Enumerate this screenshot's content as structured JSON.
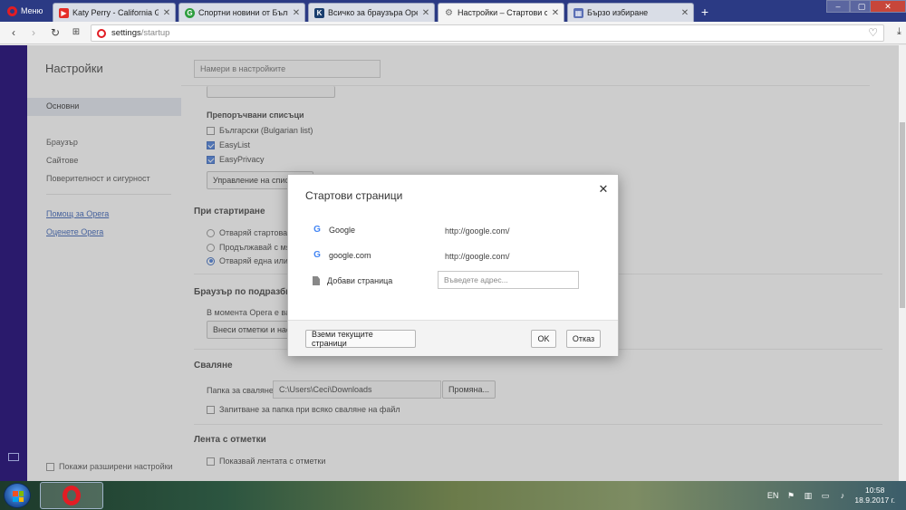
{
  "browser": {
    "menu_label": "Меню",
    "tabs": [
      {
        "title": "Katy Perry - California Gurl",
        "favicon": "youtube-icon",
        "favicon_color": "#e52d27"
      },
      {
        "title": "Спортни новини от България",
        "favicon": "green-g-icon",
        "favicon_color": "#2e9e3e"
      },
      {
        "title": "Всичко за браузъра Opera",
        "favicon": "k-icon",
        "favicon_color": "#1a3e6e"
      },
      {
        "title": "Настройки – Стартови стр",
        "favicon": "gear-icon",
        "favicon_color": "#666666"
      },
      {
        "title": "Бързо избиране",
        "favicon": "speed-dial-icon",
        "favicon_color": "#5a6fb5"
      }
    ],
    "new_tab_symbol": "+",
    "url_host": "settings",
    "url_path": "/startup",
    "accent_color": "#e21d24"
  },
  "settings": {
    "title": "Настройки",
    "search_placeholder": "Намери в настройките",
    "nav": {
      "basic": "Основни",
      "browser": "Браузър",
      "websites": "Сайтове",
      "privacy": "Поверителност и сигурност",
      "help_link": "Помощ за Opera",
      "rate_link": "Оценете Opera"
    },
    "show_advanced": "Покажи разширени настройки",
    "adblock": {
      "lists_title": "Препоръчвани списъци",
      "lists": [
        {
          "label": "Български (Bulgarian list)",
          "checked": false
        },
        {
          "label": "EasyList",
          "checked": true
        },
        {
          "label": "EasyPrivacy",
          "checked": true
        }
      ],
      "manage_button": "Управление на спис"
    },
    "startup": {
      "title": "При стартиране",
      "options": [
        {
          "label": "Отваряй стартовата",
          "selected": false
        },
        {
          "label": "Продължавай с мя",
          "selected": false
        },
        {
          "label": "Отваряй една или",
          "selected": true
        }
      ]
    },
    "default_browser": {
      "title": "Браузър по подразбир",
      "text": "В момента Opera е ваш",
      "import_button": "Внеси отметки и наст"
    },
    "downloads": {
      "title": "Сваляне",
      "folder_label": "Папка за сваляне:",
      "folder_path": "C:\\Users\\Ceci\\Downloads",
      "change_button": "Промяна...",
      "ask_label": "Запитване за папка при всяко сваляне на файл"
    },
    "bookmarks_bar": {
      "title": "Лента с отметки",
      "show_label": "Показвай лентата с отметки"
    }
  },
  "dialog": {
    "title": "Стартови страници",
    "pages": [
      {
        "name": "Google",
        "url": "http://google.com/"
      },
      {
        "name": "google.com",
        "url": "http://google.com/"
      }
    ],
    "add_page_label": "Добави страница",
    "address_placeholder": "Въведете адрес...",
    "use_current_button": "Вземи текущите страници",
    "ok_button": "OK",
    "cancel_button": "Отказ"
  },
  "taskbar": {
    "language": "EN",
    "time": "10:58",
    "date": "18.9.2017 г."
  }
}
